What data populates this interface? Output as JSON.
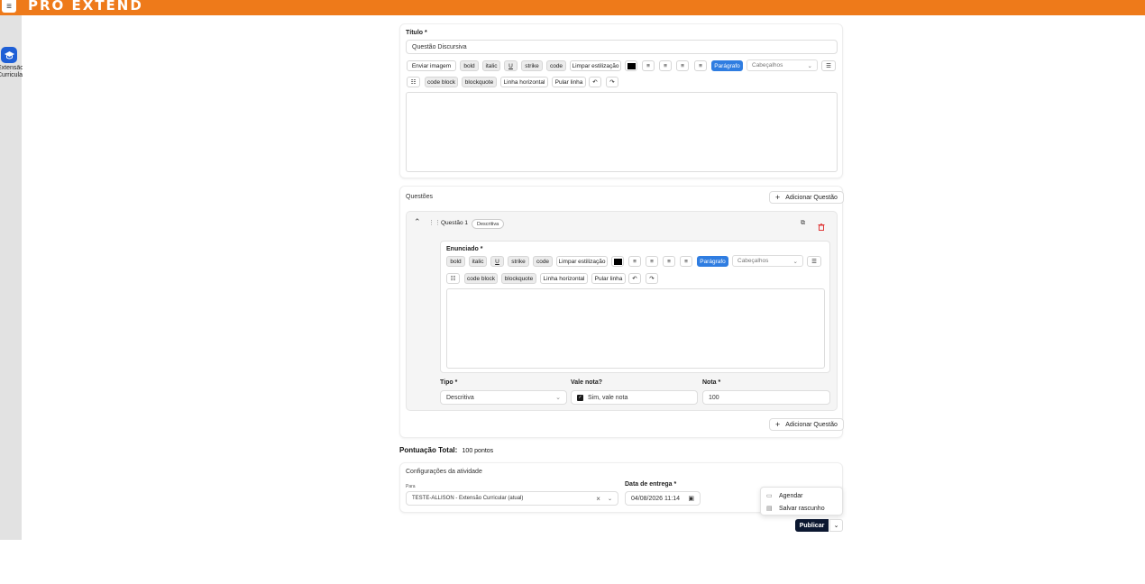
{
  "header": {
    "logo": "PRO EXTEND",
    "menu_icon": "hamburger-icon"
  },
  "sidebar": {
    "item_label_line1": "Extensão",
    "item_label_line2": "Curricular",
    "item_icon": "graduation-cap-icon"
  },
  "toolbar": {
    "send_image": "Enviar imagem",
    "bold": "bold",
    "italic": "italic",
    "underline": "U",
    "strike": "strike",
    "code": "code",
    "clear": "Limpar estilização",
    "paragraph": "Parágrafo",
    "headings": "Cabeçalhos",
    "code_block": "code block",
    "blockquote": "blockquote",
    "hr": "Linha horizontal",
    "line_break": "Pular linha",
    "undo": "↶",
    "redo": "↷",
    "align_left": "≡",
    "align_center": "≡",
    "align_right": "≡",
    "align_justify": "≡",
    "bullet_list": "☰",
    "ordered_list": "☷",
    "chevron": "⌄"
  },
  "title_section": {
    "label": "Título *",
    "value": "Questão Discursiva"
  },
  "questions": {
    "label": "Questões",
    "add_button": "Adicionar Questão",
    "items": [
      {
        "title": "Questão 1",
        "badge": "Descritiva",
        "statement_label": "Enunciado *",
        "type_label": "Tipo *",
        "type_value": "Descritiva",
        "worth_label": "Vale nota?",
        "worth_checkbox_label": "Sim, vale nota",
        "grade_label": "Nota *",
        "grade_value": "100"
      }
    ]
  },
  "total": {
    "label": "Pontuação Total:",
    "value": "100 pontos"
  },
  "settings": {
    "title": "Configurações da atividade",
    "for_label": "Para",
    "for_value": "TESTE-ALLISON - Extensão Curricular (atual)",
    "clear_icon": "×",
    "delivery_label": "Data de entrega *",
    "delivery_value": "04/08/2026 11:14"
  },
  "publish_menu": {
    "schedule": "Agendar",
    "save_draft": "Salvar rascunho"
  },
  "publish_button": "Publicar"
}
